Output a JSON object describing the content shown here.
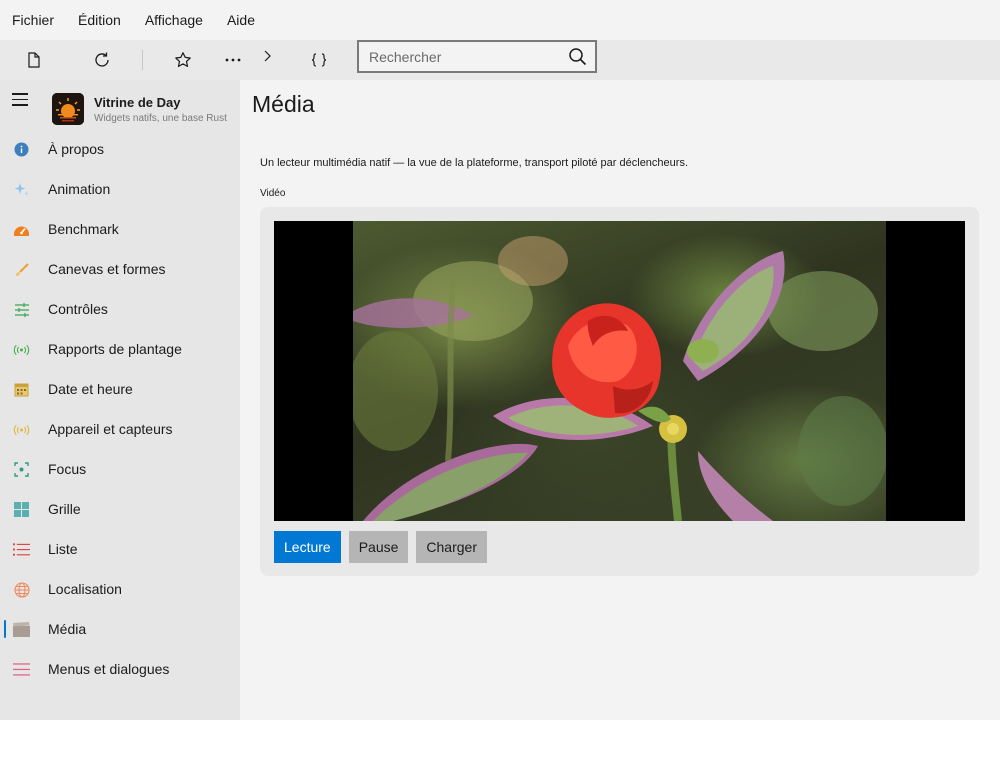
{
  "menubar": {
    "items": [
      "Fichier",
      "Édition",
      "Affichage",
      "Aide"
    ]
  },
  "toolbar": {
    "buttons": [
      "new-document-icon",
      "refresh-icon",
      "star-icon",
      "more-icon",
      "chevron-right-icon",
      "braces-icon"
    ],
    "search": {
      "placeholder": "Rechercher",
      "value": ""
    }
  },
  "sidebar": {
    "app_title": "Vitrine de Day",
    "app_subtitle": "Widgets natifs, une base Rust",
    "items": [
      {
        "label": "À propos",
        "icon": "info-icon",
        "color": "#3f7fbf"
      },
      {
        "label": "Animation",
        "icon": "sparkle-icon",
        "color": "#6fb0e8"
      },
      {
        "label": "Benchmark",
        "icon": "gauge-icon",
        "color": "#f07f22"
      },
      {
        "label": "Canevas et formes",
        "icon": "brush-icon",
        "color": "#f0a030"
      },
      {
        "label": "Contrôles",
        "icon": "sliders-icon",
        "color": "#3fa85a"
      },
      {
        "label": "Rapports de plantage",
        "icon": "broadcast-icon",
        "color": "#4caf50"
      },
      {
        "label": "Date et heure",
        "icon": "calendar-icon",
        "color": "#d9b44a"
      },
      {
        "label": "Appareil et capteurs",
        "icon": "sensor-icon",
        "color": "#e0b840"
      },
      {
        "label": "Focus",
        "icon": "focus-icon",
        "color": "#2e9e80"
      },
      {
        "label": "Grille",
        "icon": "grid-icon",
        "color": "#5ab0b0"
      },
      {
        "label": "Liste",
        "icon": "list-icon",
        "color": "#e04040"
      },
      {
        "label": "Localisation",
        "icon": "globe-icon",
        "color": "#f08a60"
      },
      {
        "label": "Média",
        "icon": "clapper-icon",
        "color": "#a89c95",
        "active": true
      },
      {
        "label": "Menus et dialogues",
        "icon": "menu-lines-icon",
        "color": "#e06080"
      }
    ]
  },
  "main": {
    "title": "Média",
    "description": "Un lecteur multimédia natif — la vue de la plateforme, transport piloté par déclencheurs.",
    "section_label": "Vidéo",
    "buttons": {
      "play": "Lecture",
      "pause": "Pause",
      "load": "Charger"
    }
  },
  "colors": {
    "accent": "#0078d4",
    "sidebar_bg": "#e6e6e6",
    "content_bg": "#f3f3f3"
  }
}
